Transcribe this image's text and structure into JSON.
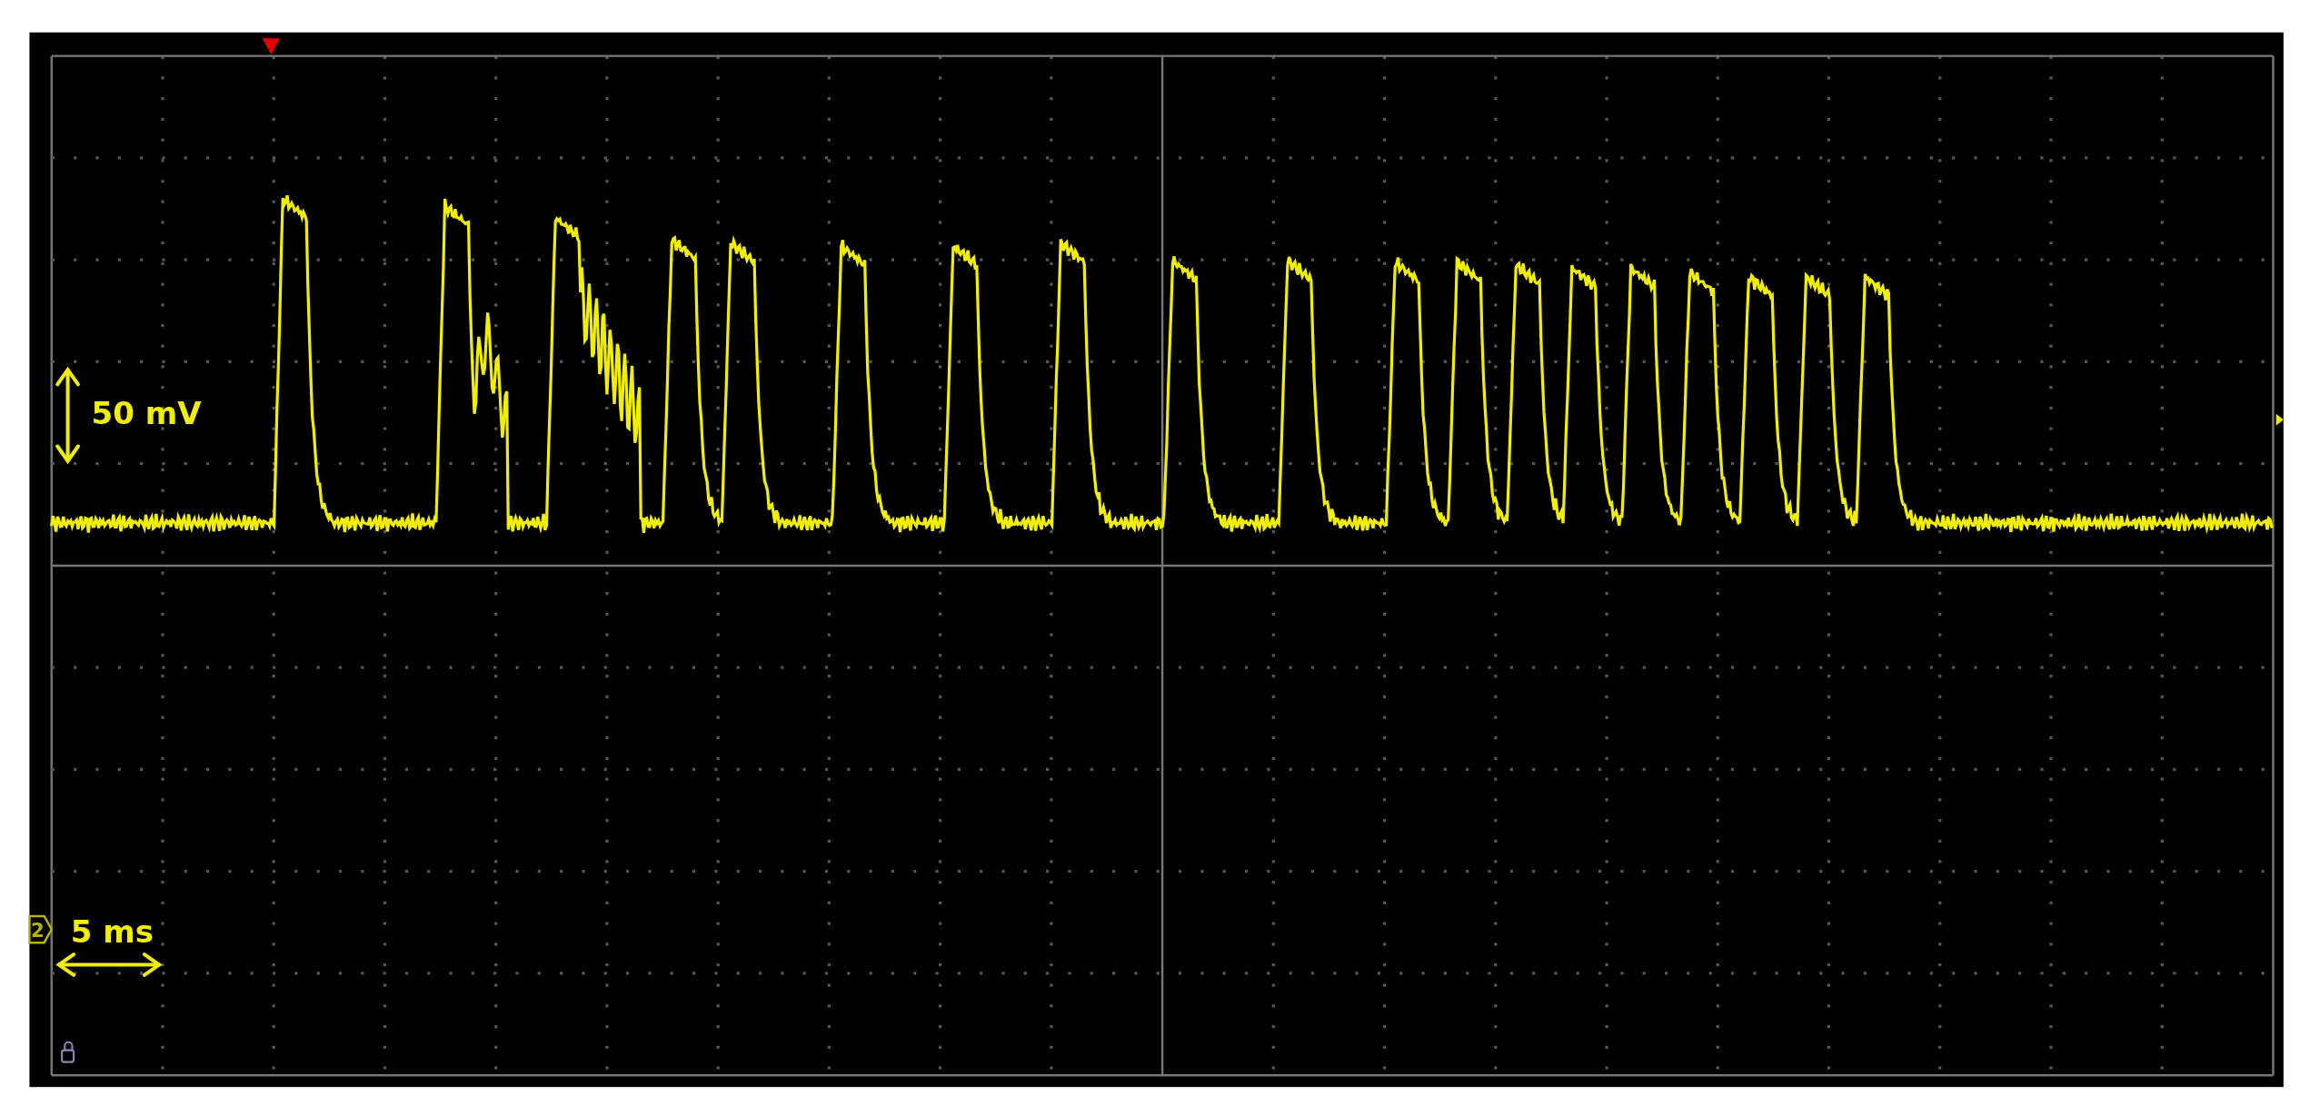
{
  "display": {
    "channel": "2",
    "vertical_scale": "50 mV",
    "horizontal_scale": "5 ms"
  }
}
